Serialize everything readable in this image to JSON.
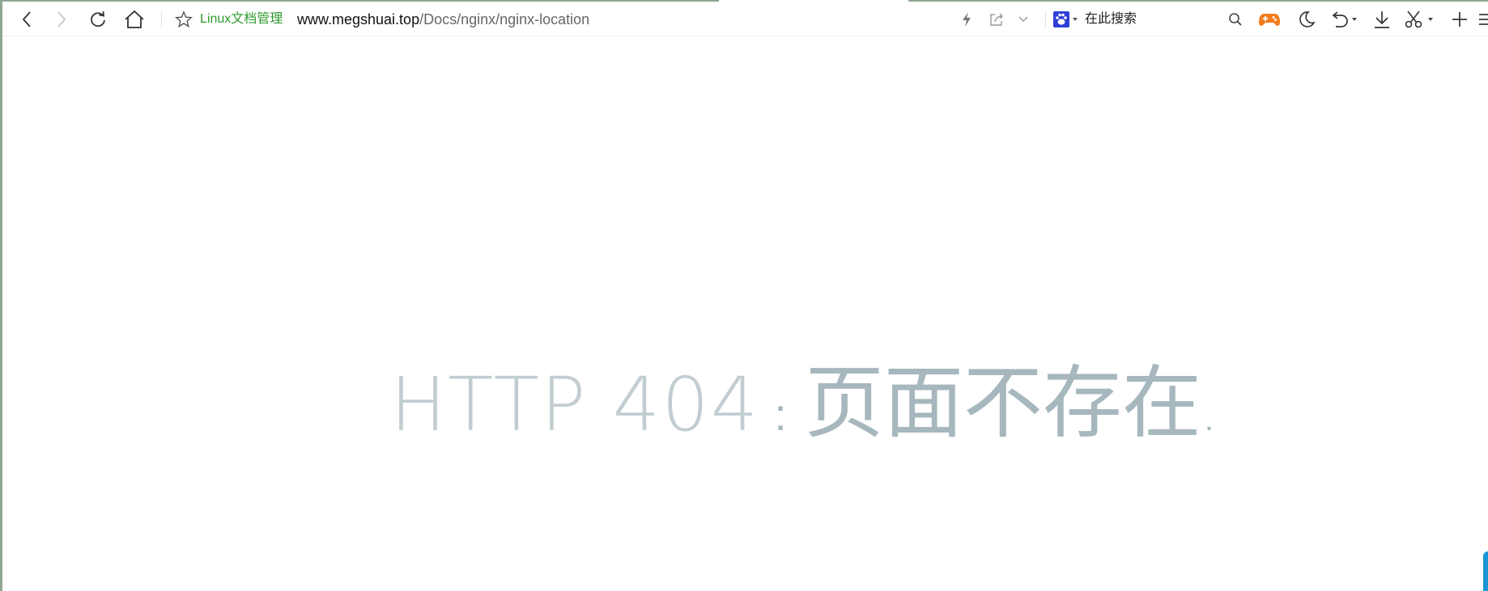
{
  "toolbar": {
    "site_name": "Linux文档管理",
    "url_host": "www.megshuai.top",
    "url_path": "/Docs/nginx/nginx-location",
    "search_placeholder": "在此搜索"
  },
  "icons": {
    "back": "arrow-left-icon",
    "forward": "arrow-right-icon",
    "reload": "reload-icon",
    "home": "home-icon",
    "bookmark": "star-icon",
    "speed": "lightning-icon",
    "share": "share-icon",
    "more": "chevron-down-icon",
    "search_engine": "baidu-paw-icon",
    "search": "search-icon",
    "game": "gamepad-icon",
    "night_mode": "moon-icon",
    "undo": "undo-icon",
    "download": "download-icon",
    "screenshot": "scissors-icon",
    "new_tab": "plus-icon",
    "menu": "menu-icon"
  },
  "colors": {
    "site_name": "#2d9b2d",
    "message": "#a6b7bd",
    "game_icon": "#f47d1f",
    "baidu": "#2f3fd8"
  },
  "page": {
    "code": "HTTP 404",
    "colon": ":",
    "message": "页面不存在",
    "dot": "."
  }
}
